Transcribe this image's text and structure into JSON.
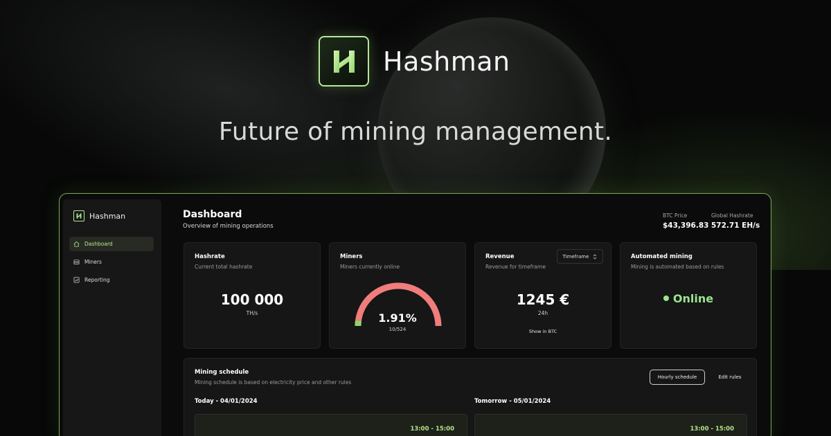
{
  "hero": {
    "brand": "Hashman",
    "tagline": "Future of mining management."
  },
  "sidebar": {
    "brand": "Hashman",
    "items": [
      {
        "label": "Dashboard",
        "icon": "home-icon",
        "active": true
      },
      {
        "label": "Miners",
        "icon": "server-icon",
        "active": false
      },
      {
        "label": "Reporting",
        "icon": "chart-icon",
        "active": false
      }
    ]
  },
  "header": {
    "title": "Dashboard",
    "subtitle": "Overview of mining operations",
    "btc_price_label": "BTC Price",
    "btc_price_value": "$43,396.83",
    "global_hashrate_label": "Global Hashrate",
    "global_hashrate_value": "572.71 EH/s"
  },
  "cards": {
    "hashrate": {
      "title": "Hashrate",
      "subtitle": "Current total hashrate",
      "value": "100 000",
      "unit": "TH/s"
    },
    "miners": {
      "title": "Miners",
      "subtitle": "Miners currently online",
      "value": "1.91%",
      "detail": "10/524",
      "online_fraction": 0.0191
    },
    "revenue": {
      "title": "Revenue",
      "subtitle": "Revenue for timeframe",
      "timeframe_label": "Timeframe",
      "value": "1245 €",
      "period": "24h",
      "link": "Show in BTC"
    },
    "automated": {
      "title": "Automated mining",
      "subtitle": "Mining is automated based on rules",
      "status": "Online"
    }
  },
  "schedule": {
    "title": "Mining schedule",
    "subtitle": "Mining schedule is based on electricity price and other rules",
    "hourly_button": "Hourly schedule",
    "edit_button": "Edit rules",
    "today_label": "Today - 04/01/2024",
    "tomorrow_label": "Tomorrow - 05/01/2024",
    "today_slot": "13:00 - 15:00",
    "tomorrow_slot": "13:00 - 15:00"
  },
  "colors": {
    "accent": "#b9e694",
    "gauge": "#f07c7c",
    "online": "#9be48f",
    "border": "#7ea85a"
  }
}
